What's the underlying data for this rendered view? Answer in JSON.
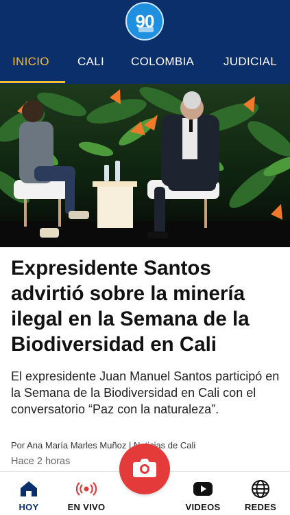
{
  "brand": {
    "logo_text": "90"
  },
  "tabs": [
    {
      "label": "INICIO",
      "active": true
    },
    {
      "label": "CALI",
      "active": false
    },
    {
      "label": "COLOMBIA",
      "active": false
    },
    {
      "label": "JUDICIAL",
      "active": false
    }
  ],
  "article": {
    "headline": "Expresidente Santos advirtió sobre la minería ilegal en la Semana de la Biodiversidad en Cali",
    "summary": "El expresidente Juan Manuel Santos participó en la Semana de la Biodiversidad en Cali con el conversatorio “Paz con la naturaleza”.",
    "byline": "Por Ana María Marles Muñoz | Noticias de Cali",
    "time": "Hace 2 horas"
  },
  "bottom_nav": [
    {
      "label": "HOY",
      "icon": "home-icon",
      "active": true
    },
    {
      "label": "EN VIVO",
      "icon": "live-broadcast-icon",
      "active": false
    },
    {
      "label": "VIDEOS",
      "icon": "youtube-icon",
      "active": false
    },
    {
      "label": "REDES",
      "icon": "globe-icon",
      "active": false
    }
  ],
  "camera": {
    "icon": "camera-icon"
  },
  "colors": {
    "header_bg": "#0b2f6b",
    "active_tab": "#f2c230",
    "camera_bg": "#e53a3a",
    "live_red": "#e53a3a"
  }
}
